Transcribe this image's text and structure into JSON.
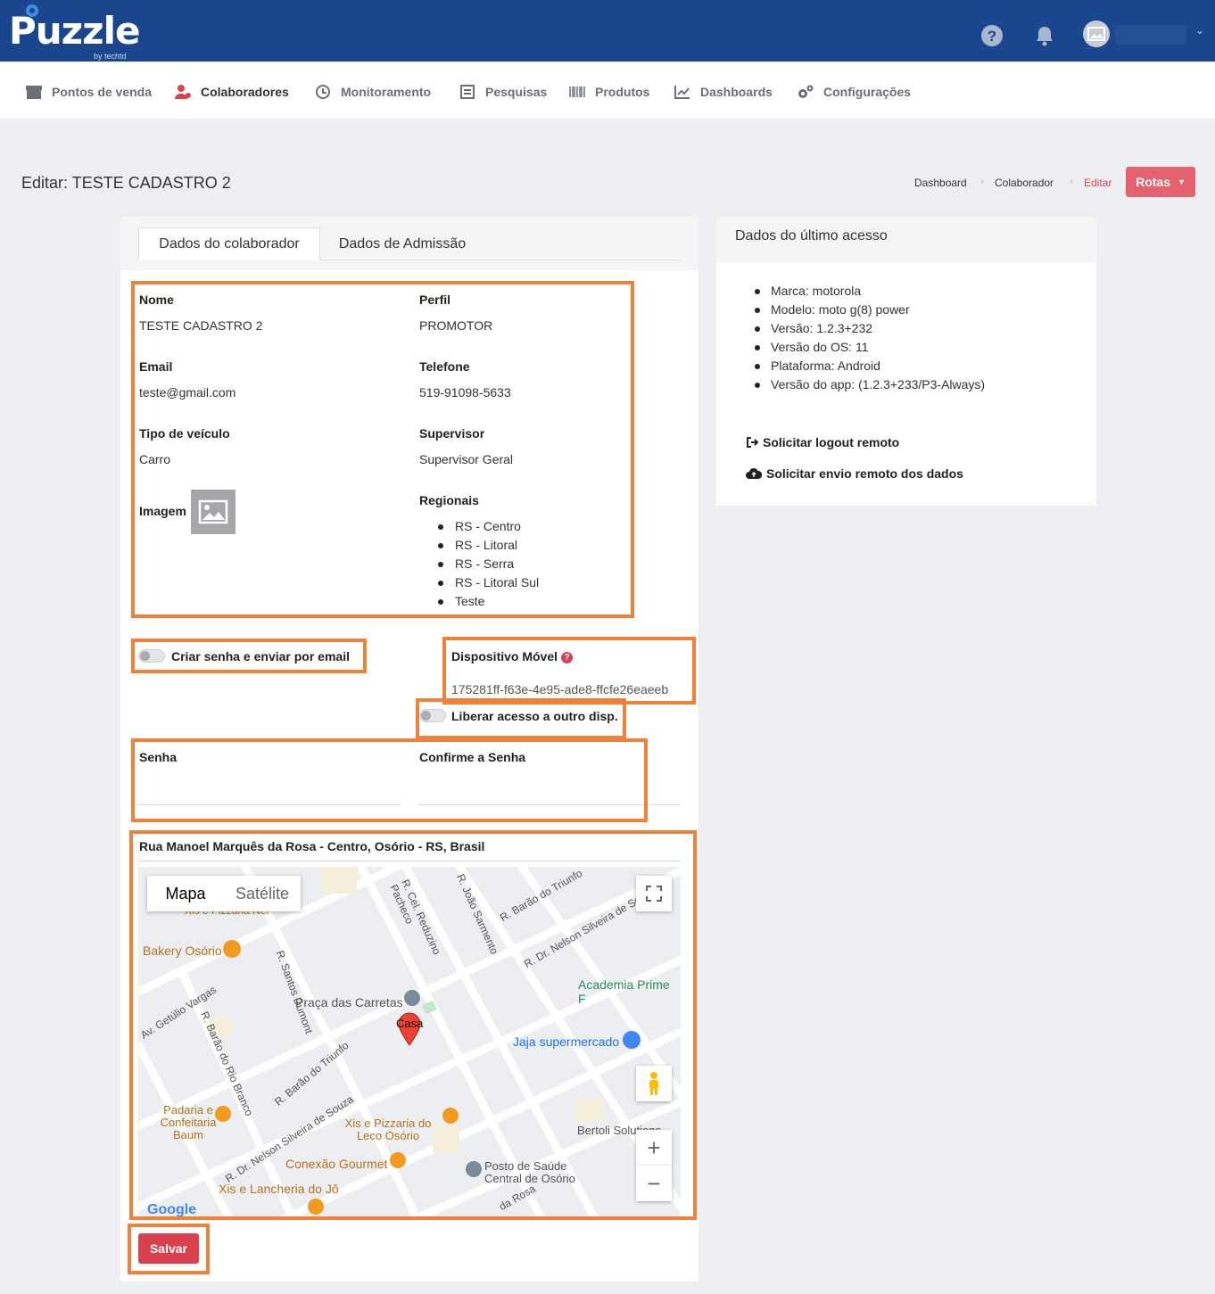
{
  "brand": {
    "name": "Puzzle",
    "sub": "by techtd"
  },
  "colors": {
    "header": "#1a468e",
    "accent": "#e5616d",
    "danger": "#d9414e",
    "highlight": "#f0813a"
  },
  "header_icons": [
    "help-icon",
    "bell-icon",
    "avatar"
  ],
  "nav": [
    {
      "label": "Pontos de venda",
      "icon": "store-icon"
    },
    {
      "label": "Colaboradores",
      "icon": "users-icon",
      "active": true
    },
    {
      "label": "Monitoramento",
      "icon": "clock-icon"
    },
    {
      "label": "Pesquisas",
      "icon": "survey-icon"
    },
    {
      "label": "Produtos",
      "icon": "barcode-icon"
    },
    {
      "label": "Dashboards",
      "icon": "chart-icon"
    },
    {
      "label": "Configurações",
      "icon": "gears-icon"
    }
  ],
  "page": {
    "title": "Editar: TESTE CADASTRO 2"
  },
  "breadcrumb": [
    "Dashboard",
    "Colaborador",
    "Editar"
  ],
  "rotas_label": "Rotas",
  "tabs": [
    "Dados do colaborador",
    "Dados de Admissão"
  ],
  "form": {
    "nome_label": "Nome",
    "nome": "TESTE CADASTRO 2",
    "perfil_label": "Perfil",
    "perfil": "PROMOTOR",
    "email_label": "Email",
    "email": "teste@gmail.com",
    "telefone_label": "Telefone",
    "telefone": "519-91098-5633",
    "veiculo_label": "Tipo de veículo",
    "veiculo": "Carro",
    "supervisor_label": "Supervisor",
    "supervisor": "Supervisor Geral",
    "imagem_label": "Imagem",
    "regionais_label": "Regionais",
    "regionais": [
      "RS - Centro",
      "RS - Litoral",
      "RS - Serra",
      "RS - Litoral Sul",
      "Teste"
    ],
    "criar_senha_label": "Criar senha e enviar por email",
    "dispositivo_label": "Dispositivo Móvel",
    "dispositivo_id": "175281ff-f63e-4e95-ade8-ffcfe26eaeeb",
    "liberar_label": "Liberar acesso a outro disp.",
    "senha_label": "Senha",
    "confirme_label": "Confirme a Senha",
    "endereco": "Rua Manoel Marquês da Rosa - Centro, Osório - RS, Brasil"
  },
  "map": {
    "type_map": "Mapa",
    "type_sat": "Satélite",
    "marker": "Casa",
    "places": [
      "Bakery Osório",
      "Praça das Carretas",
      "Jaja supermercado",
      "Academia Prime F",
      "Padaria e Confeitaria Baum",
      "Xis e Pizzaria do Leco Osório",
      "Conexão Gourmet",
      "Posto de Saúde Central de Osório",
      "Xis e Lancheria do Jô",
      "Bertoli Solutions",
      "Xis e Pizzaria Nei"
    ],
    "streets": [
      "R. Santos Dumont",
      "R. Cel. Reduzino Pacheco",
      "R. João Sarmento",
      "R. Barão do Triunfo",
      "R. Dr. Nelson Silveira de Souza",
      "Av. Getúlio Vargas",
      "R. Barão do Rio Branco",
      "R. Barão do Triunfo",
      "R. Dr. Nelson Silveira de Souza",
      "da Rosa"
    ],
    "logo": "Google"
  },
  "save_label": "Salvar",
  "last_access": {
    "title": "Dados do último acesso",
    "items": [
      "Marca: motorola",
      "Modelo: moto g(8) power",
      "Versão: 1.2.3+232",
      "Versão do OS: 11",
      "Plataforma: Android",
      "Versão do app: (1.2.3+233/P3-Always)"
    ],
    "logout_label": "Solicitar logout remoto",
    "envio_label": "Solicitar envio remoto dos dados"
  }
}
